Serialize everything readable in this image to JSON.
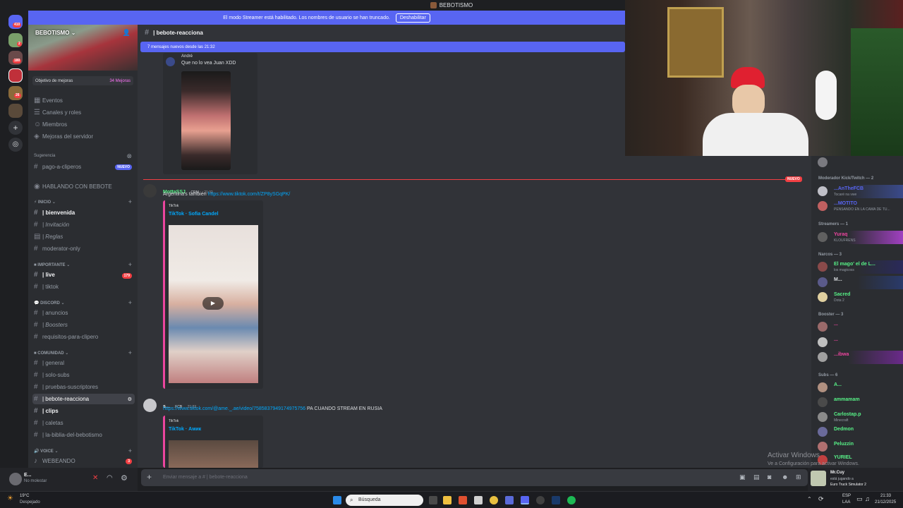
{
  "window": {
    "title": "BEBOTISMO"
  },
  "streamer_banner": {
    "text": "El modo Streamer está habilitado. Los nombres de usuario se han truncado.",
    "button": "Deshabilitar"
  },
  "rail": {
    "badges": [
      "410",
      "2",
      "180",
      "26"
    ]
  },
  "server": {
    "name": "BEBOTISMO",
    "boost_goal": "Objetivo de mejoras",
    "boost_count": "34 Mejoras",
    "menu": [
      "Eventos",
      "Canales y roles",
      "Miembros",
      "Mejoras del servidor"
    ],
    "suggestion_header": "Sugerencia",
    "suggestion_channel": "pago-a-cliperos",
    "suggestion_tag": "NUEVO",
    "hablando": "HABLANDO CON BEBOTE",
    "categories": {
      "inicio": "INICIO",
      "importante": "IMPORTANTE",
      "discord": "DISCORD",
      "comunidad": "COMUNIDAD",
      "voice": "VOICE"
    },
    "channels_inicio": [
      "| bienvenida",
      "| Invitación",
      "| Reglas",
      "moderator-only"
    ],
    "channels_importante": [
      "| live",
      "| tiktok"
    ],
    "live_badge": "179",
    "channels_discord": [
      "| anuncios",
      "| Boosters",
      "requisitos-para-clipero"
    ],
    "channels_comunidad": [
      "| general",
      "| solo-subs",
      "| pruebas-suscriptores",
      "| bebote-reacciona",
      "| clips",
      "| caletas",
      "| la-biblia-del-bebotismo"
    ],
    "voice_channel": "WEBEANDO",
    "voice_badge": "3"
  },
  "user": {
    "name": "E...",
    "status": "No molestar"
  },
  "chat": {
    "channel": "| bebote-reacciona",
    "new_messages": "7 mensajes nuevos desde las 21:32",
    "nuevo_label": "NUEVO",
    "msg0": {
      "author": "André",
      "text": "Que no lo vea Juan XDD"
    },
    "msg1": {
      "author": "MottaSSJ",
      "tag": "CRM",
      "time": "21:32",
      "text": "Argentina's también",
      "link": "https://www.tiktok.com/t/ZP8ySGqPK/",
      "embed_provider": "TikTok",
      "embed_title": "TikTok · Sofia Candel"
    },
    "msg2": {
      "author": "s...",
      "tag": "FCB",
      "time": "21:33",
      "link": "https://www.tiktok.com/@ame._.ae/video/7585837949174975756",
      "text": "PA CUANDO STREAM EN RUSIA",
      "embed_provider": "TikTok",
      "embed_title": "TikTok · Амик"
    },
    "composer_placeholder": "Enviar mensaje a #",
    "composer_channel": "| bebote-reacciona"
  },
  "members": {
    "groups": [
      "Moderador Kick/Twitch — 2",
      "Streamers — 1",
      "Narcos — 3",
      "Booster — 3",
      "Subs — 6"
    ],
    "list": [
      {
        "name": "...AnTheFCB",
        "status": "Tocaré na vwe",
        "color": "#5865f2"
      },
      {
        "name": "...MOTITO",
        "status": "PENSANDO EN LA CAMA DE TU...",
        "color": "#5865f2"
      },
      {
        "name": "Yuraq",
        "status": "KLOUFRENS",
        "color": "#eb459e"
      },
      {
        "name": "El mago' el de L...",
        "status": "los magicoss",
        "color": "#57f287"
      },
      {
        "name": "M...",
        "status": "",
        "color": "#dbdee1"
      },
      {
        "name": "Sacred",
        "status": "Dota 2",
        "color": "#57f287"
      },
      {
        "name": "...",
        "status": "",
        "color": "#eb459e"
      },
      {
        "name": "...",
        "status": "",
        "color": "#eb459e"
      },
      {
        "name": "...ibwa",
        "status": "",
        "color": "#eb459e"
      },
      {
        "name": "A...",
        "status": "",
        "color": "#57f287"
      },
      {
        "name": "ammamam",
        "status": "",
        "color": "#57f287"
      },
      {
        "name": "Carlostap.p",
        "status": "Minecraft",
        "color": "#57f287"
      },
      {
        "name": "Dedmon",
        "status": "",
        "color": "#57f287"
      },
      {
        "name": "Peluzzin",
        "status": "",
        "color": "#57f287"
      },
      {
        "name": "YURIEL",
        "status": "",
        "color": "#57f287"
      }
    ]
  },
  "game_activity": {
    "name": "Mr.Cuy",
    "line1": "está jugando a",
    "line2": "Euro Truck Simulator 2"
  },
  "watermark": {
    "line1": "Activar Windows",
    "line2": "Ve a Configuración para activar Windows."
  },
  "taskbar": {
    "weather_temp": "19°C",
    "weather_desc": "Despejado",
    "search": "Búsqueda",
    "lang1": "ESP",
    "lang2": "LAA",
    "time": "21:33",
    "date": "21/12/2025"
  }
}
